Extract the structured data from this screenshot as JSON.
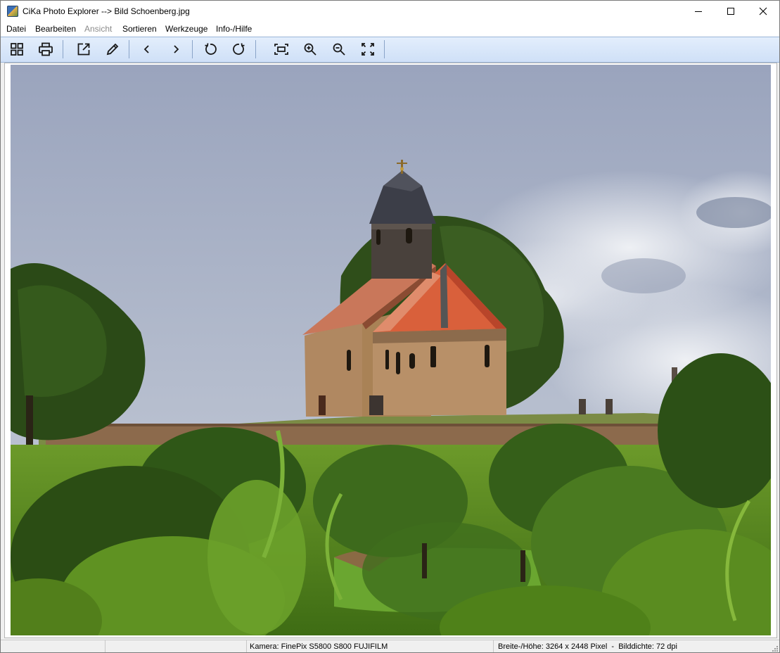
{
  "window": {
    "title": "CiKa Photo Explorer --> Bild Schoenberg.jpg",
    "icon": "app-photo-icon"
  },
  "menu": [
    {
      "label": "Datei",
      "enabled": true
    },
    {
      "label": "Bearbeiten",
      "enabled": true
    },
    {
      "label": "Ansicht",
      "enabled": false
    },
    {
      "label": "Sortieren",
      "enabled": true
    },
    {
      "label": "Werkzeuge",
      "enabled": true
    },
    {
      "label": "Info-/Hilfe",
      "enabled": true
    }
  ],
  "toolbar": {
    "icons": [
      "thumbnail-grid-icon",
      "print-icon",
      "open-external-icon",
      "edit-pencil-icon",
      "previous-chevron-icon",
      "next-chevron-icon",
      "rotate-left-icon",
      "rotate-right-icon",
      "fit-to-window-icon",
      "zoom-in-icon",
      "zoom-out-icon",
      "fullscreen-icon"
    ]
  },
  "viewer": {
    "image_subject": "church-on-hill-photo"
  },
  "status": {
    "panel1": "",
    "panel2": "",
    "camera": "Kamera: FinePix S5800 S800 FUJIFILM",
    "dimensions": "Breite-/Höhe: 3264 x 2448 Pixel  -  Bilddichte: 72 dpi"
  },
  "colors": {
    "toolbar_top": "#e3eefc",
    "toolbar_bottom": "#cfe0f7",
    "sky": "#a4aec6",
    "foliage": "#3c6a1a",
    "roof": "#d35a37"
  }
}
